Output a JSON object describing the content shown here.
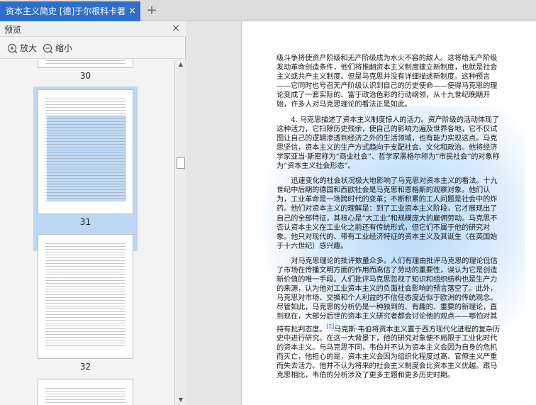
{
  "tab": {
    "title": "资本主义简史 [德]于尔根科卡著",
    "close": "×",
    "add": "+"
  },
  "panel": {
    "title": "预览",
    "close": "×",
    "zoom_in": "放大",
    "zoom_out": "缩小"
  },
  "thumbnails": [
    {
      "page": "30"
    },
    {
      "page": "31",
      "selected": true
    },
    {
      "page": "32"
    }
  ],
  "document": {
    "p0": "级斗争将使资产阶级和无产阶级成为水火不容的敌人。这将给无产阶级发动革命创造条件，他们将推翻资本主义制度建立新制度，也就是社会主义或共产主义制度。但是马克思并没有详细描述新制度。这种预言——它同时也号召无产阶级认识到自己的历史使命——使得马克思的理论变成了一套实际的、富于政治色彩的行动纲领，从十九世纪晚期开始，许多人对马克思理论的看法正是如此。",
    "p1": "4. 马克思描述了资本主义制度惊人的活力。资产阶级的活动体现了这种活力，它扫除历史残余，使自己的影响力遍及世界各地，它不仅试图让自己的逻辑渗透到经济之外的生活领域，也有能力实现这点。马克思坚信，资本主义的生产方式趋向于支配社会、文化和政治。他将经济学家亚当·斯密称为“商业社会”、哲学家黑格尔称为“市民社会”的对象称为“资本主义社会形态”。",
    "p2": "迅速变化的社会状况极大地影响了马克思对资本主义的看法。十九世纪中后期的德国和西欧社会是马克思和恩格斯的观察对象。他们认为，工业革命是一场跨时代的变革；不断积累的工人问题是社会中的炸药。他们对资本主义的理解是：到了工业资本主义阶段，它才展现出了自己的全部特征，其核心是“大工业”和规模庞大的雇佣劳动。马克思不否认资本主义在工业化之前还有传统形式，但它们不属于他的研究对象。他只对现代的、带有工业经济特征的资本主义及其诞生（在英国始于十六世纪）感兴趣。",
    "p3a": "对马克思理论的批评数量众多。人们有理由批评马克思的理论低估了市场在传播文明方面的作用而高估了劳动的重要性，误认为它是创造新价值的唯一手段。人们批评马克思忽视了知识和组织结构也是生产力的来源，认为他对工业资本主义的负面社会影响的预言落空了。此外，马克思对市场、交换和个人利益的不信任态度近似于欧洲的传统观念。尽管如此，马克思的分析仍是一种独到的、有趣的、重要的新理论，直到现在，大部分后世的资本主义研究者都会讨论他的观点——哪怕对其持有批判态度。",
    "footnote": "[2]",
    "p3b": "马克斯·韦伯将资本主义置于西方现代化进程的复杂历史中进行研究。在这一大背景下，他的研究对象便不局限于工业化时代的资本主义。与马克思不同，韦伯并不认为资本主义会因为自身的危机而灭亡，他担心的是，资本主义会因为组织化程度过高、官僚主义严重而失去活力。他并不认为将来的社会主义制度会比资本主义优越。跟马克思相比，韦伯的分析涉及了更多主题和更多历史时期。"
  }
}
